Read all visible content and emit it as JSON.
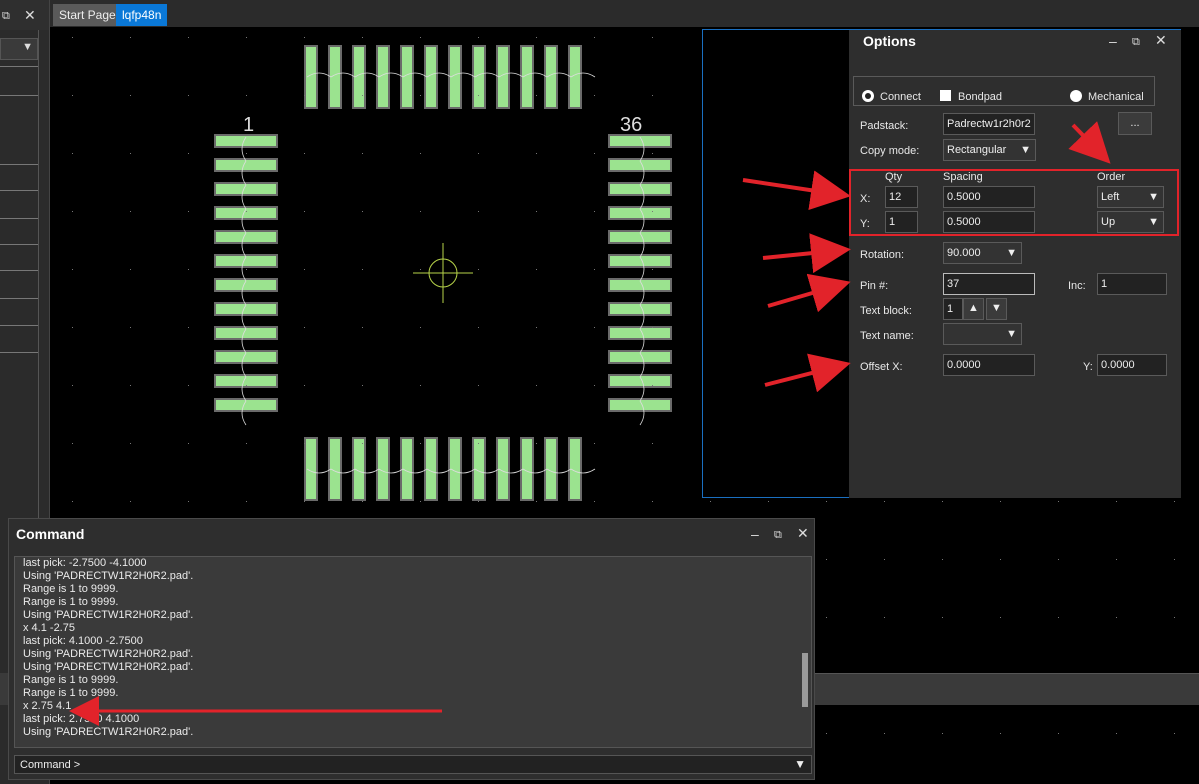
{
  "tabs": {
    "start_page": "Start Page",
    "active": "lqfp48n"
  },
  "options": {
    "title": "Options",
    "mode_connect": "Connect",
    "mode_bondpad": "Bondpad",
    "mode_mechanical": "Mechanical",
    "padstack_label": "Padstack:",
    "padstack_value": "Padrectw1r2h0r2",
    "browse_label": "...",
    "copy_mode_label": "Copy mode:",
    "copy_mode_value": "Rectangular",
    "qty_header": "Qty",
    "spacing_header": "Spacing",
    "order_header": "Order",
    "x_label": "X:",
    "x_qty": "12",
    "x_spacing": "0.5000",
    "x_order": "Left",
    "y_label": "Y:",
    "y_qty": "1",
    "y_spacing": "0.5000",
    "y_order": "Up",
    "rotation_label": "Rotation:",
    "rotation_value": "90.000",
    "pin_label": "Pin #:",
    "pin_value": "37",
    "inc_label": "Inc:",
    "inc_value": "1",
    "text_block_label": "Text block:",
    "text_block_value": "1",
    "text_name_label": "Text name:",
    "text_name_value": "",
    "offset_x_label": "Offset X:",
    "offset_x_value": "0.0000",
    "offset_y_label": "Y:",
    "offset_y_value": "0.0000"
  },
  "command": {
    "title": "Command",
    "log": [
      "last pick:  -2.7500 -4.1000",
      "Using 'PADRECTW1R2H0R2.pad'.",
      "Range is 1 to 9999.",
      "Range is 1 to 9999.",
      "Using 'PADRECTW1R2H0R2.pad'.",
      "x 4.1 -2.75",
      "last pick:  4.1000 -2.7500",
      "Using 'PADRECTW1R2H0R2.pad'.",
      "Using 'PADRECTW1R2H0R2.pad'.",
      "Range is 1 to 9999.",
      "Range is 1 to 9999.",
      "x 2.75 4.1",
      "last pick:  2.7500 4.1000",
      "Using 'PADRECTW1R2H0R2.pad'."
    ],
    "prompt": "Command >"
  },
  "canvas": {
    "pin_label_left": "1",
    "pin_label_right": "36",
    "pad_color": "#9be38f",
    "pad_border": "#6a6a6a"
  },
  "colors": {
    "accent": "#0a78d7",
    "annotation": "#e2232a"
  }
}
